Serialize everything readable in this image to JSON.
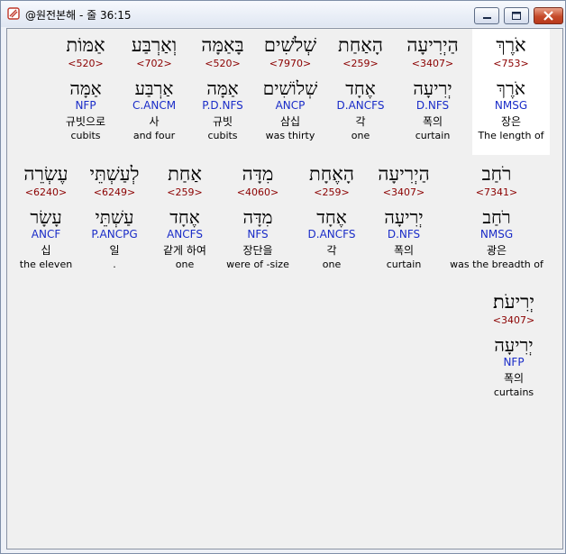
{
  "window": {
    "title": "@원전본해 - 줄 36:15",
    "controls": {
      "minimize": "minimize",
      "maximize": "maximize",
      "close": "close"
    }
  },
  "rows": [
    [
      {
        "heb": "אֹרֶךְ",
        "num": "<753>",
        "lemma": "אֹרֶךְ",
        "pos": "NMSG",
        "ko": "장은",
        "en": "The length of",
        "highlight": true
      },
      {
        "heb": "הַיְרִיעָה",
        "num": "<3407>",
        "lemma": "יְרִיעָה",
        "pos": "D.NFS",
        "ko": "폭의",
        "en": "curtain"
      },
      {
        "heb": "הָאַחַת",
        "num": "<259>",
        "lemma": "אֶחָד",
        "pos": "D.ANCFS",
        "ko": "각",
        "en": "one"
      },
      {
        "heb": "שְׁלֹשִׁים",
        "num": "<7970>",
        "lemma": "שְׁלוֹשִׁים",
        "pos": "ANCP",
        "ko": "삼십",
        "en": "was thirty"
      },
      {
        "heb": "בָּאַמָּה",
        "num": "<520>",
        "lemma": "אַמָּה",
        "pos": "P.D.NFS",
        "ko": "규빗",
        "en": "cubits"
      },
      {
        "heb": "וְאַרְבַּע",
        "num": "<702>",
        "lemma": "אַרְבַּע",
        "pos": "C.ANCM",
        "ko": "사",
        "en": "and four"
      },
      {
        "heb": "אַמּוֹת",
        "num": "<520>",
        "lemma": "אַמָּה",
        "pos": "NFP",
        "ko": "규빗으로",
        "en": "cubits"
      }
    ],
    [
      {
        "heb": "רֹחַב",
        "num": "<7341>",
        "lemma": "רֹחַב",
        "pos": "NMSG",
        "ko": "광은",
        "en": "was the breadth of"
      },
      {
        "heb": "הַיְרִיעָה",
        "num": "<3407>",
        "lemma": "יְרִיעָה",
        "pos": "D.NFS",
        "ko": "폭의",
        "en": "curtain"
      },
      {
        "heb": "הָאֶחָת",
        "num": "<259>",
        "lemma": "אֶחָד",
        "pos": "D.ANCFS",
        "ko": "각",
        "en": "one"
      },
      {
        "heb": "מִדָּה",
        "num": "<4060>",
        "lemma": "מִדָּה",
        "pos": "NFS",
        "ko": "장단을",
        "en": "were of -size"
      },
      {
        "heb": "אַחַת",
        "num": "<259>",
        "lemma": "אֶחָד",
        "pos": "ANCFS",
        "ko": "같게 하여",
        "en": "one"
      },
      {
        "heb": "לְעַשְׁתֵּי",
        "num": "<6249>",
        "lemma": "עַשְׁתֵּי",
        "pos": "P.ANCPG",
        "ko": "일",
        "en": "."
      },
      {
        "heb": "עֶשְׂרֵה",
        "num": "<6240>",
        "lemma": "עָשָׂר",
        "pos": "ANCF",
        "ko": "십",
        "en": "the eleven"
      }
    ],
    [
      {
        "heb": "יְרִיעֹת׃",
        "num": "<3407>",
        "lemma": "יְרִיעָה",
        "pos": "NFP",
        "ko": "폭의",
        "en": "curtains"
      }
    ]
  ]
}
